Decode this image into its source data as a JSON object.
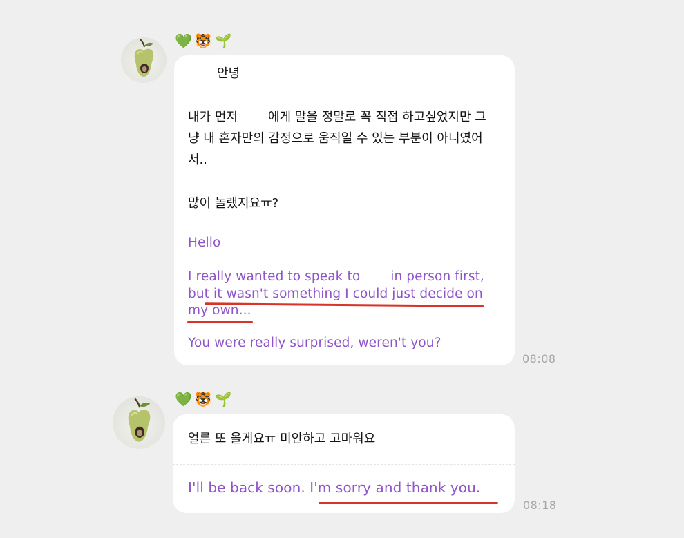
{
  "messages": [
    {
      "emojis": {
        "heart": "💚",
        "tiger": "🐯",
        "sprout": "🌱"
      },
      "korean": {
        "greeting": "안녕",
        "line1a": "내가 먼저",
        "line1b": "에게 말을 정말로 꼭 직접 하고싶었지만 그",
        "line2": "냥 내 혼자만의 감정으로 움직일 수 있는 부분이 아니였어",
        "line3": "서..",
        "line4": "많이 놀랬지요ㅠ?"
      },
      "translation": {
        "hello": "Hello",
        "line1a": "I really wanted to speak to",
        "line1b": "in person first,",
        "line2": "but it wasn't something I could just decide on",
        "line3": "my own...",
        "line4": "You were really surprised, weren't you?"
      },
      "time": "08:08"
    },
    {
      "emojis": {
        "heart": "💚",
        "tiger": "🐯",
        "sprout": "🌱"
      },
      "korean": {
        "line1": "얼른 또 올게요ㅠ 미안하고 고마워요"
      },
      "translation": {
        "line1": "I'll be back soon. I'm sorry and thank you."
      },
      "time": "08:18"
    }
  ],
  "colors": {
    "background": "#efefef",
    "bubble": "#ffffff",
    "korean_text": "#141414",
    "translation_text": "#8e54c9",
    "timestamp": "#a6a6a6",
    "underline": "#d8322a"
  }
}
